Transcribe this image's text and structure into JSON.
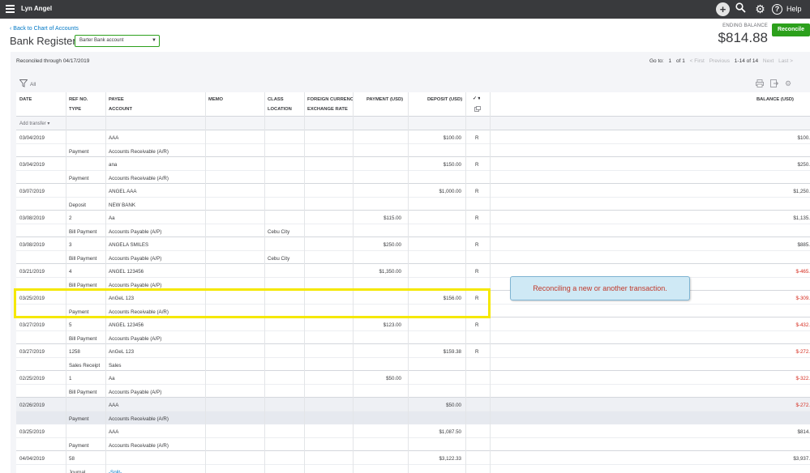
{
  "topbar": {
    "company": "Lyn Angel",
    "help": "Help"
  },
  "header": {
    "back_link": "Back to Chart of Accounts",
    "title": "Bank Register",
    "account": "Barter Bank account",
    "ending_label": "ENDING BALANCE",
    "ending_value": "$814.88",
    "reconcile": "Reconcile"
  },
  "toolbar": {
    "reconciled_through": "Reconciled through 04/17/2019",
    "goto": "Go to:",
    "page": "1",
    "of": "of 1",
    "first": "< First",
    "previous": "Previous",
    "range": "1-14 of 14",
    "next": "Next",
    "last": "Last >",
    "filter_all": "All"
  },
  "columns": {
    "date": "DATE",
    "ref": "REF NO.",
    "type": "TYPE",
    "payee": "PAYEE",
    "account": "ACCOUNT",
    "memo": "MEMO",
    "class": "CLASS",
    "location": "LOCATION",
    "foreign": "FOREIGN CURRENC",
    "exchange": "EXCHANGE RATE",
    "payment": "PAYMENT (USD)",
    "deposit": "DEPOSIT (USD)",
    "check": "✓ ▾",
    "balance": "BALANCE (USD)"
  },
  "add_transfer": "Add transfer ▾",
  "rows": [
    {
      "date": "03/04/2019",
      "ref": "",
      "type": "Payment",
      "payee": "AAA",
      "account": "Accounts Receivable (A/R)",
      "class": "",
      "payment": "",
      "deposit": "$100.00",
      "status": "R",
      "balance": "$100."
    },
    {
      "date": "03/04/2019",
      "ref": "",
      "type": "Payment",
      "payee": "ana",
      "account": "Accounts Receivable (A/R)",
      "class": "",
      "payment": "",
      "deposit": "$150.00",
      "status": "R",
      "balance": "$250."
    },
    {
      "date": "03/07/2019",
      "ref": "",
      "type": "Deposit",
      "payee": "ANGEL AAA",
      "account": "NEW BANK",
      "class": "",
      "payment": "",
      "deposit": "$1,000.00",
      "status": "R",
      "balance": "$1,250."
    },
    {
      "date": "03/08/2019",
      "ref": "2",
      "type": "Bill Payment",
      "payee": "Aa",
      "account": "Accounts Payable (A/P)",
      "class": "Cebu City",
      "payment": "$115.00",
      "deposit": "",
      "status": "R",
      "balance": "$1,135."
    },
    {
      "date": "03/08/2019",
      "ref": "3",
      "type": "Bill Payment",
      "payee": "ANGELA SMILES",
      "account": "Accounts Payable (A/P)",
      "class": "Cebu City",
      "payment": "$250.00",
      "deposit": "",
      "status": "R",
      "balance": "$885."
    },
    {
      "date": "03/21/2019",
      "ref": "4",
      "type": "Bill Payment",
      "payee": "ANGEL 123456",
      "account": "Accounts Payable (A/P)",
      "class": "",
      "payment": "$1,350.00",
      "deposit": "",
      "status": "R",
      "balance": "$-465."
    },
    {
      "date": "03/25/2019",
      "ref": "",
      "type": "Payment",
      "payee": "AnGeL 123",
      "account": "Accounts Receivable (A/R)",
      "class": "",
      "payment": "",
      "deposit": "$156.00",
      "status": "R",
      "balance": "$-309."
    },
    {
      "date": "03/27/2019",
      "ref": "5",
      "type": "Bill Payment",
      "payee": "ANGEL 123456",
      "account": "Accounts Payable (A/P)",
      "class": "",
      "payment": "$123.00",
      "deposit": "",
      "status": "R",
      "balance": "$-432."
    },
    {
      "date": "03/27/2019",
      "ref": "1258",
      "type": "Sales Receipt",
      "payee": "AnGeL 123",
      "account": "Sales",
      "class": "",
      "payment": "",
      "deposit": "$159.38",
      "status": "R",
      "balance": "$-272."
    },
    {
      "date": "02/25/2019",
      "ref": "1",
      "type": "Bill Payment",
      "payee": "Aa",
      "account": "Accounts Payable (A/P)",
      "class": "",
      "payment": "$50.00",
      "deposit": "",
      "status": "",
      "balance": "$-322."
    },
    {
      "date": "02/26/2019",
      "ref": "",
      "type": "Payment",
      "payee": "AAA",
      "account": "Accounts Receivable (A/R)",
      "class": "",
      "payment": "",
      "deposit": "$50.00",
      "status": "",
      "balance": "$-272."
    },
    {
      "date": "03/25/2019",
      "ref": "",
      "type": "Payment",
      "payee": "AAA",
      "account": "Accounts Receivable (A/R)",
      "class": "",
      "payment": "",
      "deposit": "$1,087.50",
      "status": "",
      "balance": "$814."
    },
    {
      "date": "04/04/2019",
      "ref": "58",
      "type": "Journal",
      "payee": "",
      "account": "-Split-",
      "class": "",
      "payment": "",
      "deposit": "$3,122.33",
      "status": "",
      "balance": "$3,937."
    }
  ],
  "callout": "Reconciling a new or another transaction."
}
